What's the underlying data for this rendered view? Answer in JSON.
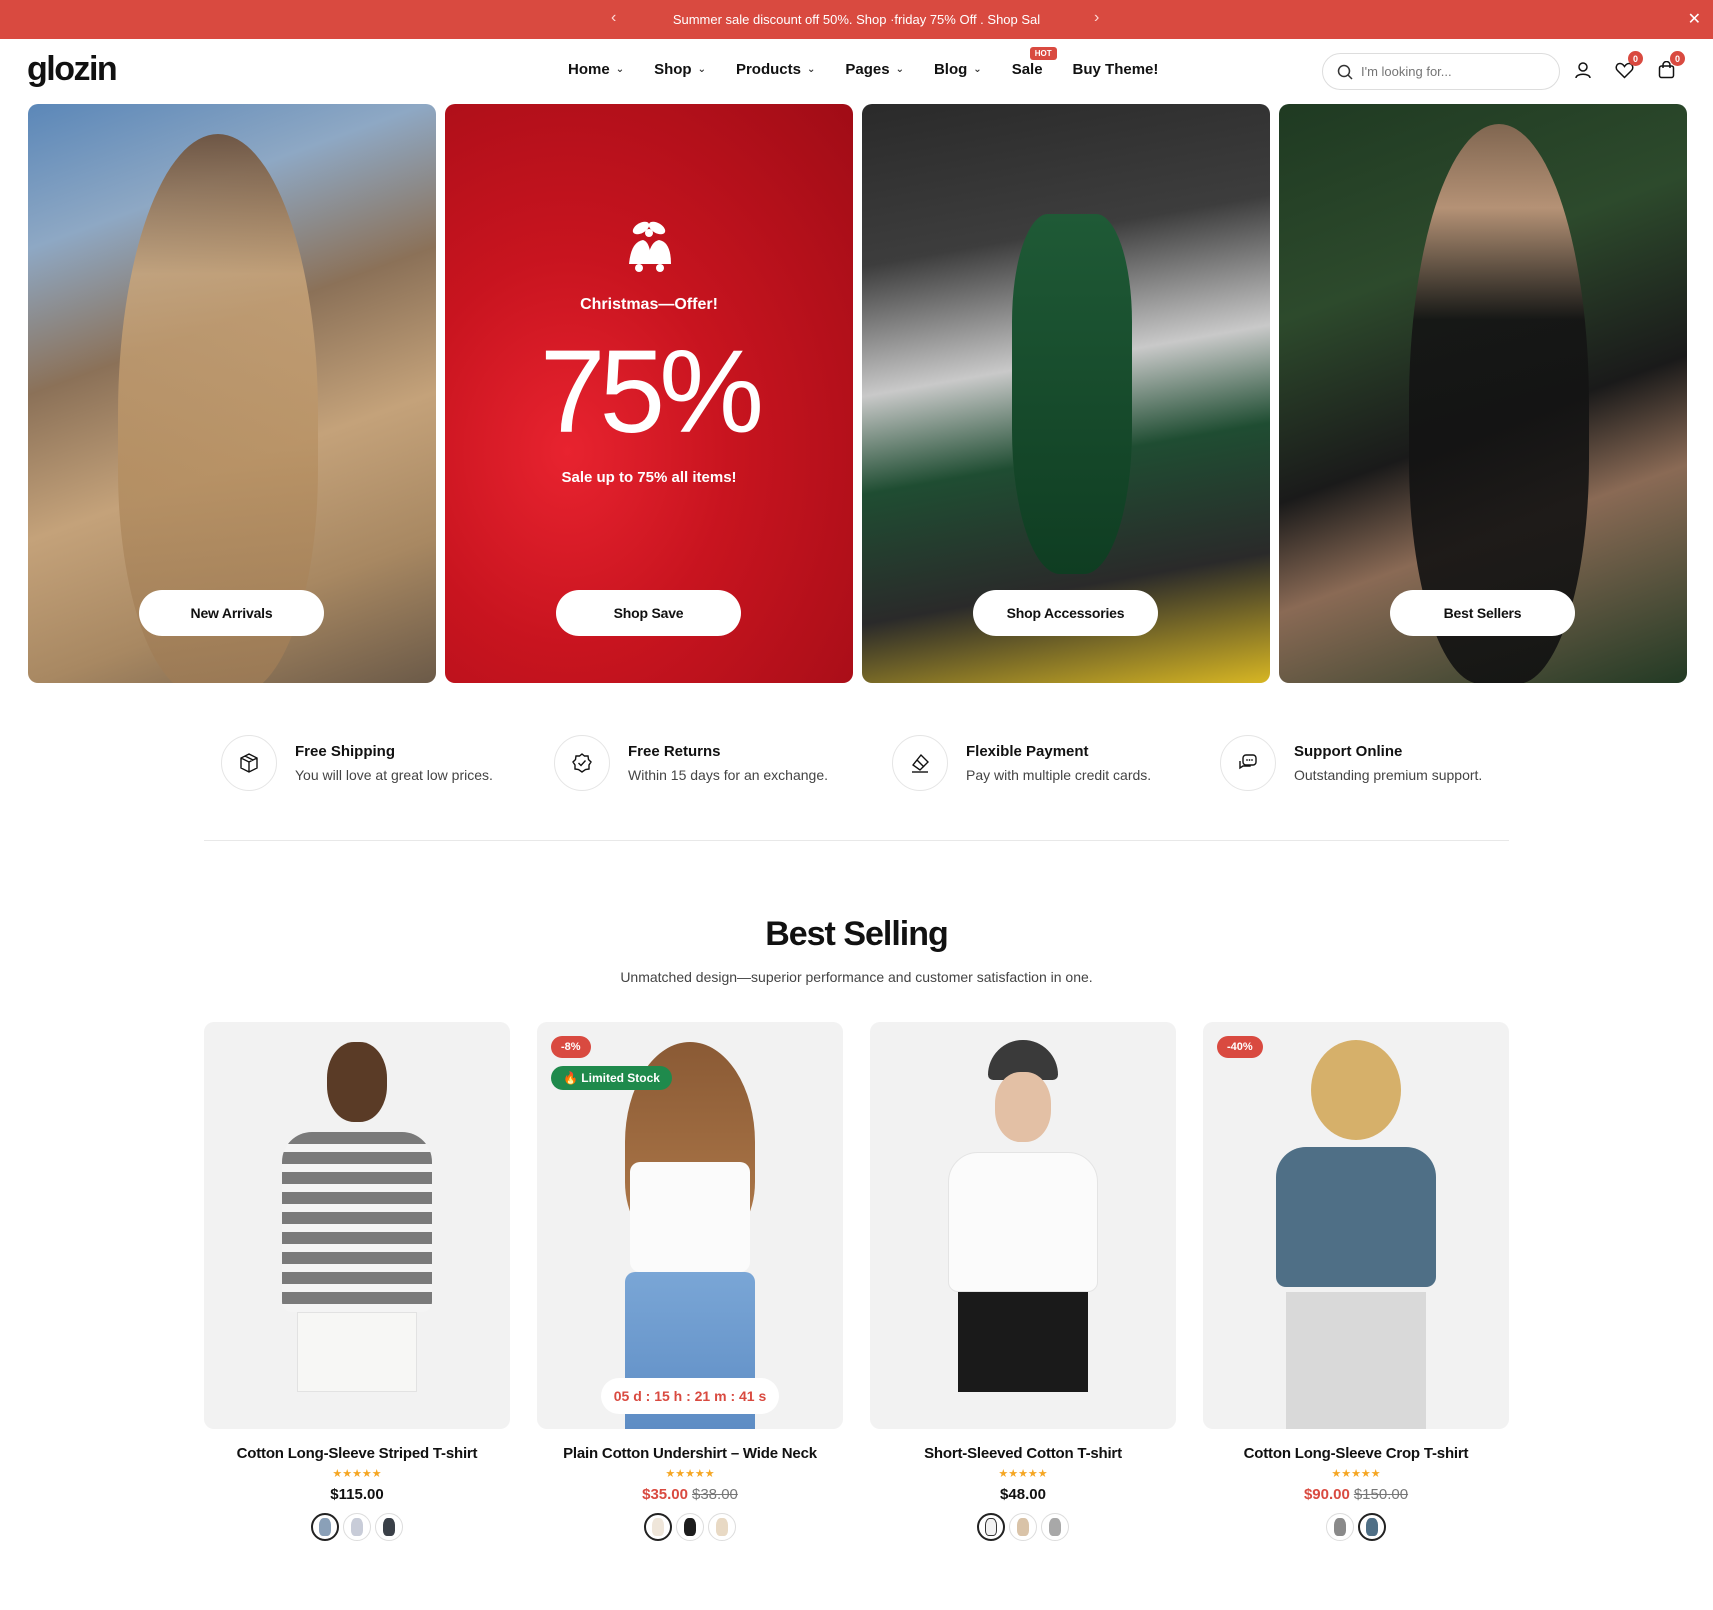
{
  "announcement": {
    "text": "Summer sale discount off 50%. Shop  ·friday 75% Off . Shop Sal",
    "prev_icon": "chevron-left-icon",
    "next_icon": "chevron-right-icon",
    "close_icon": "close-icon"
  },
  "header": {
    "logo": "glozin",
    "nav": [
      {
        "label": "Home",
        "has_dropdown": true
      },
      {
        "label": "Shop",
        "has_dropdown": true
      },
      {
        "label": "Products",
        "has_dropdown": true
      },
      {
        "label": "Pages",
        "has_dropdown": true
      },
      {
        "label": "Blog",
        "has_dropdown": true
      },
      {
        "label": "Sale",
        "has_dropdown": false,
        "badge": "HOT"
      },
      {
        "label": "Buy Theme!",
        "has_dropdown": false
      }
    ],
    "search_placeholder": "I'm looking for...",
    "wishlist_count": "0",
    "cart_count": "0"
  },
  "hero": {
    "banners": [
      {
        "button": "New Arrivals"
      },
      {
        "title": "Christmas—Offer!",
        "big": "75%",
        "subtitle": "Sale up to 75% all items!",
        "button": "Shop Save"
      },
      {
        "button": "Shop Accessories"
      },
      {
        "button": "Best Sellers"
      }
    ]
  },
  "features": [
    {
      "title": "Free Shipping",
      "desc": "You will love at great low prices.",
      "icon": "box-icon"
    },
    {
      "title": "Free Returns",
      "desc": "Within 15 days for an exchange.",
      "icon": "badge-check-icon"
    },
    {
      "title": "Flexible Payment",
      "desc": "Pay with multiple credit cards.",
      "icon": "payment-icon"
    },
    {
      "title": "Support Online",
      "desc": "Outstanding premium support.",
      "icon": "chat-icon"
    }
  ],
  "best_selling": {
    "title": "Best Selling",
    "subtitle": "Unmatched design—superior performance and customer satisfaction in one.",
    "products": [
      {
        "name": "Cotton Long-Sleeve Striped T-shirt",
        "stars": "★★★★★",
        "price": "$115.00",
        "old_price": ""
      },
      {
        "name": "Plain Cotton Undershirt – Wide Neck",
        "stars": "★★★★★",
        "price": "$35.00",
        "old_price": "$38.00",
        "sale_badge": "-8%",
        "stock_badge": "Limited Stock",
        "countdown": "05 d : 15 h : 21 m : 41 s"
      },
      {
        "name": "Short-Sleeved Cotton T-shirt",
        "stars": "★★★★★",
        "price": "$48.00",
        "old_price": ""
      },
      {
        "name": "Cotton Long-Sleeve Crop T-shirt",
        "stars": "★★★★★",
        "price": "$90.00",
        "old_price": "$150.00",
        "sale_badge": "-40%"
      }
    ]
  },
  "colors": {
    "accent": "#d94a40",
    "stock_green": "#1f8a4c",
    "star": "#f5a623"
  }
}
